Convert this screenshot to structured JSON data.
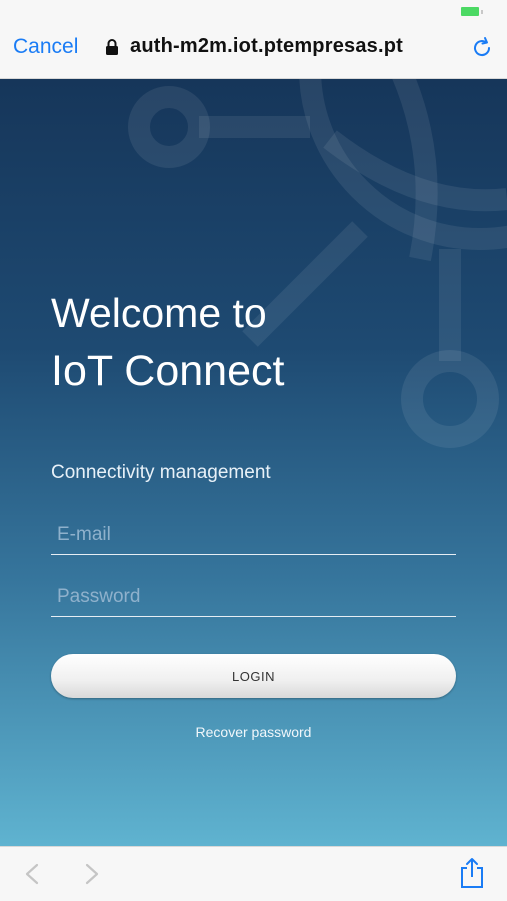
{
  "browser": {
    "cancel_label": "Cancel",
    "url": "auth-m2m.iot.ptempresas.pt",
    "icons": [
      "lock-icon",
      "reload-icon",
      "back-icon",
      "forward-icon",
      "share-icon"
    ]
  },
  "login": {
    "welcome": "Welcome to",
    "product": "IoT Connect",
    "subtitle": "Connectivity management",
    "email_placeholder": "E-mail",
    "password_placeholder": "Password",
    "login_label": "LOGIN",
    "recover_label": "Recover password"
  },
  "colors": {
    "accent": "#1a7cf5",
    "battery": "#4cd964",
    "gradient_top": "#16365a",
    "gradient_bottom": "#5fb3d0"
  }
}
